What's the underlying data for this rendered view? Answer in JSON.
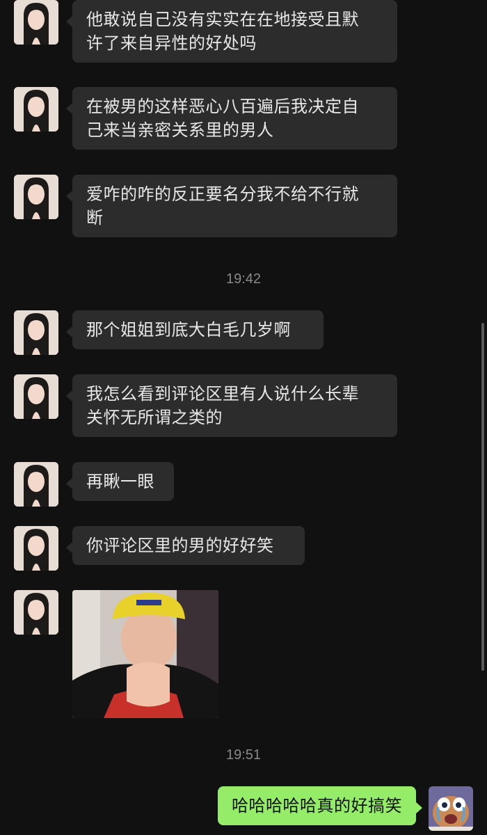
{
  "messages": [
    {
      "text_line1": "他敢说自己没有实实在在地接受且默",
      "text_line2": "许了来自异性的好处吗"
    },
    {
      "text_line1": "在被男的这样恶心八百遍后我决定自",
      "text_line2": "己来当亲密关系里的男人"
    },
    {
      "text_line1": "爱咋的咋的反正要名分我不给不行就",
      "text_line2": "断"
    },
    {
      "text_line1": "那个姐姐到底大白毛几岁啊"
    },
    {
      "text_line1": "我怎么看到评论区里有人说什么长辈",
      "text_line2": "关怀无所谓之类的"
    },
    {
      "text_line1": "再瞅一眼"
    },
    {
      "text_line1": "你评论区里的男的好好笑"
    }
  ],
  "timestamps": {
    "t1": "19:42",
    "t2": "19:51"
  },
  "reply": {
    "text": "哈哈哈哈哈真的好搞笑"
  },
  "colors": {
    "background": "#111111",
    "incoming_bubble": "#2c2c2c",
    "outgoing_bubble": "#95ec69"
  }
}
